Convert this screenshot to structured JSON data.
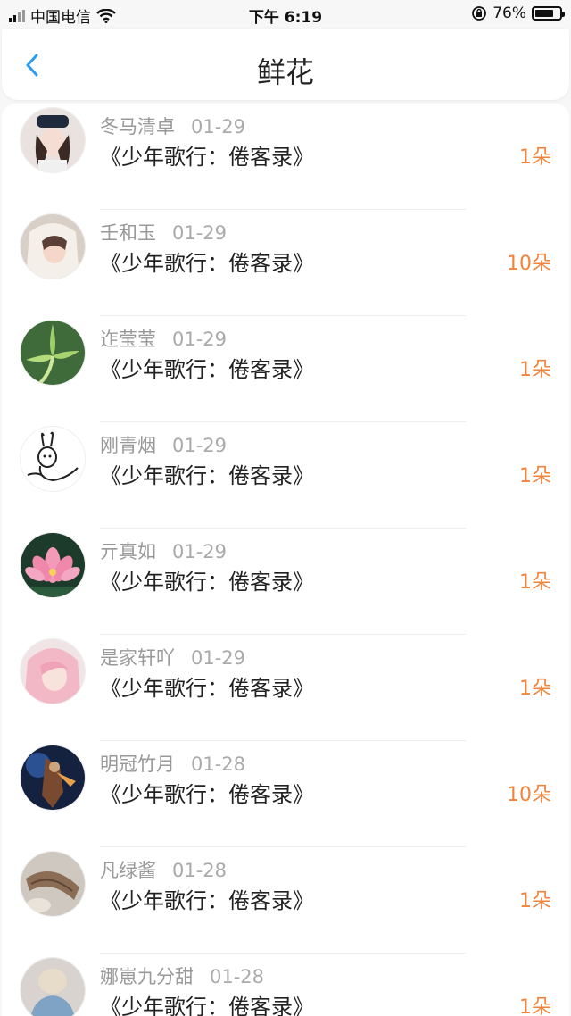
{
  "status_bar": {
    "carrier": "中国电信",
    "time": "下午 6:19",
    "battery": "76%",
    "battery_level": 0.76
  },
  "nav": {
    "title": "鲜花",
    "back_icon": "chevron-left-icon",
    "accent": "#2a9bf0"
  },
  "colors": {
    "count": "#f0843c"
  },
  "items": [
    {
      "name": "冬马清卓",
      "date": "01-29",
      "book": "《少年歌行：倦客录》",
      "count": "1朵"
    },
    {
      "name": "壬和玉",
      "date": "01-29",
      "book": "《少年歌行：倦客录》",
      "count": "10朵"
    },
    {
      "name": "迮莹莹",
      "date": "01-29",
      "book": "《少年歌行：倦客录》",
      "count": "1朵"
    },
    {
      "name": "刚青烟",
      "date": "01-29",
      "book": "《少年歌行：倦客录》",
      "count": "1朵"
    },
    {
      "name": "亓真如",
      "date": "01-29",
      "book": "《少年歌行：倦客录》",
      "count": "1朵"
    },
    {
      "name": "是家轩吖",
      "date": "01-29",
      "book": "《少年歌行：倦客录》",
      "count": "1朵"
    },
    {
      "name": "明冠竹月",
      "date": "01-28",
      "book": "《少年歌行：倦客录》",
      "count": "10朵"
    },
    {
      "name": "凡绿酱",
      "date": "01-28",
      "book": "《少年歌行：倦客录》",
      "count": "1朵"
    },
    {
      "name": "娜崽九分甜",
      "date": "01-28",
      "book": "《少年歌行：倦客录》",
      "count": "1朵"
    }
  ]
}
